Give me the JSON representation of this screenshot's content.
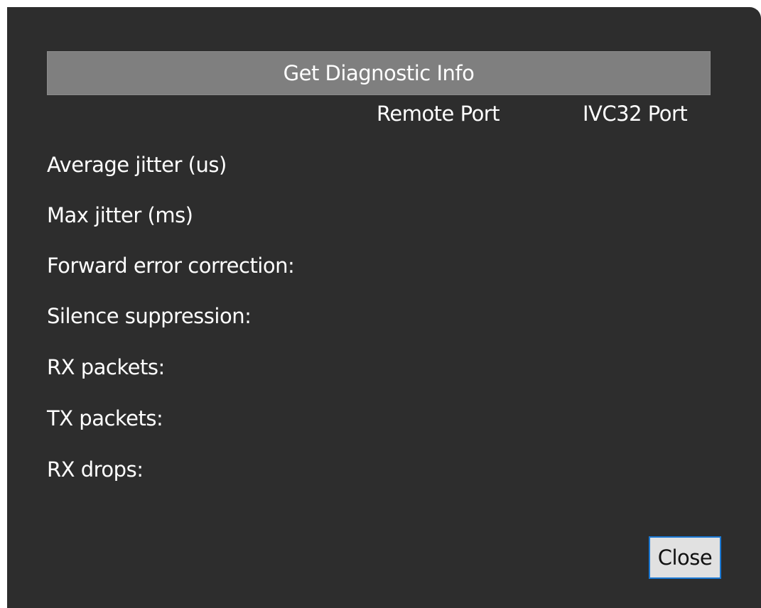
{
  "dialog": {
    "diagnostic_button_label": "Get Diagnostic Info",
    "columns": {
      "remote": "Remote Port",
      "ivc32": "IVC32 Port"
    },
    "rows": [
      {
        "label": "Average jitter (us)"
      },
      {
        "label": "Max jitter (ms)"
      },
      {
        "label": "Forward error correction:"
      },
      {
        "label": "Silence suppression:"
      },
      {
        "label": "RX packets:"
      },
      {
        "label": "TX packets:"
      },
      {
        "label": "RX drops:"
      }
    ],
    "close_label": "Close"
  }
}
